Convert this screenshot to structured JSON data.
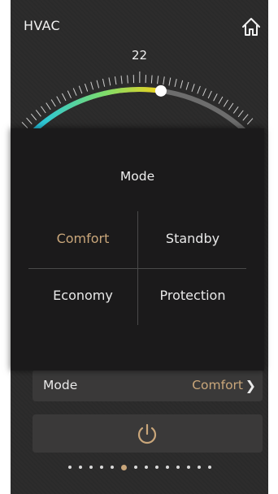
{
  "header": {
    "title": "HVAC",
    "home_icon": "home-icon"
  },
  "thermostat": {
    "setpoint": "22",
    "arc_colors": [
      "#21c4e6",
      "#7cdc6c",
      "#f0d21c"
    ]
  },
  "mode_popup": {
    "title": "Mode",
    "options": [
      {
        "label": "Comfort",
        "active": true
      },
      {
        "label": "Standby",
        "active": false
      },
      {
        "label": "Economy",
        "active": false
      },
      {
        "label": "Protection",
        "active": false
      }
    ]
  },
  "mode_row": {
    "label": "Mode",
    "value": "Comfort",
    "chevron_icon": "chevron-right-icon"
  },
  "power_button": {
    "icon": "power-icon"
  },
  "pagination": {
    "count": 14,
    "active_index": 5
  },
  "colors": {
    "accent": "#c9a67a",
    "background": "#2b2a2a",
    "popup": "#1b1a1b"
  }
}
